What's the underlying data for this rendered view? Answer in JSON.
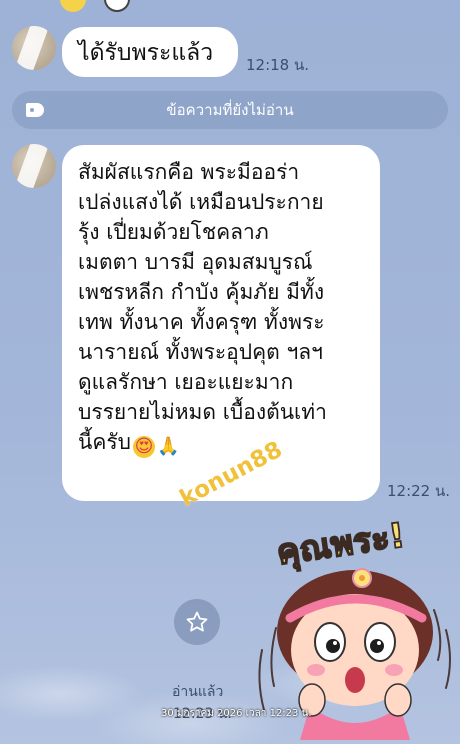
{
  "chat": {
    "messages": [
      {
        "text": "ได้รับพระแล้ว",
        "time": "12:18 น."
      },
      {
        "lines": [
          "สัมผัสแรกคือ พระมีออร่า",
          "เปล่งแสงได้ เหมือนประกาย",
          "รุ้ง เปี่ยมด้วยโชคลาภ",
          "เมตตา บารมี อุดมสมบูรณ์",
          "เพชรหลีก กำบัง คุ้มภัย มีทั้ง",
          "เทพ ทั้งนาค ทั้งครุฑ ทั้งพระ",
          "นารายณ์ ทั้งพระอุปคุต ฯลฯ",
          "ดูแลรักษา เยอะแยะมาก",
          "บรรยายไม่หมด เบื้องต้นเท่า",
          "นี้ครับ"
        ],
        "emoji_1": "😍",
        "emoji_2": "🙏",
        "time": "12:22 น."
      }
    ],
    "unread_divider": "ข้อความที่ยังไม่อ่าน",
    "watermark": "konun88",
    "sticker_text": "คุณพระ!",
    "read_label": "อ่านแล้ว",
    "last_time": "12:23 น.",
    "date_stamp": "30 มกราคม 2026 เวลา 12:23 น."
  }
}
